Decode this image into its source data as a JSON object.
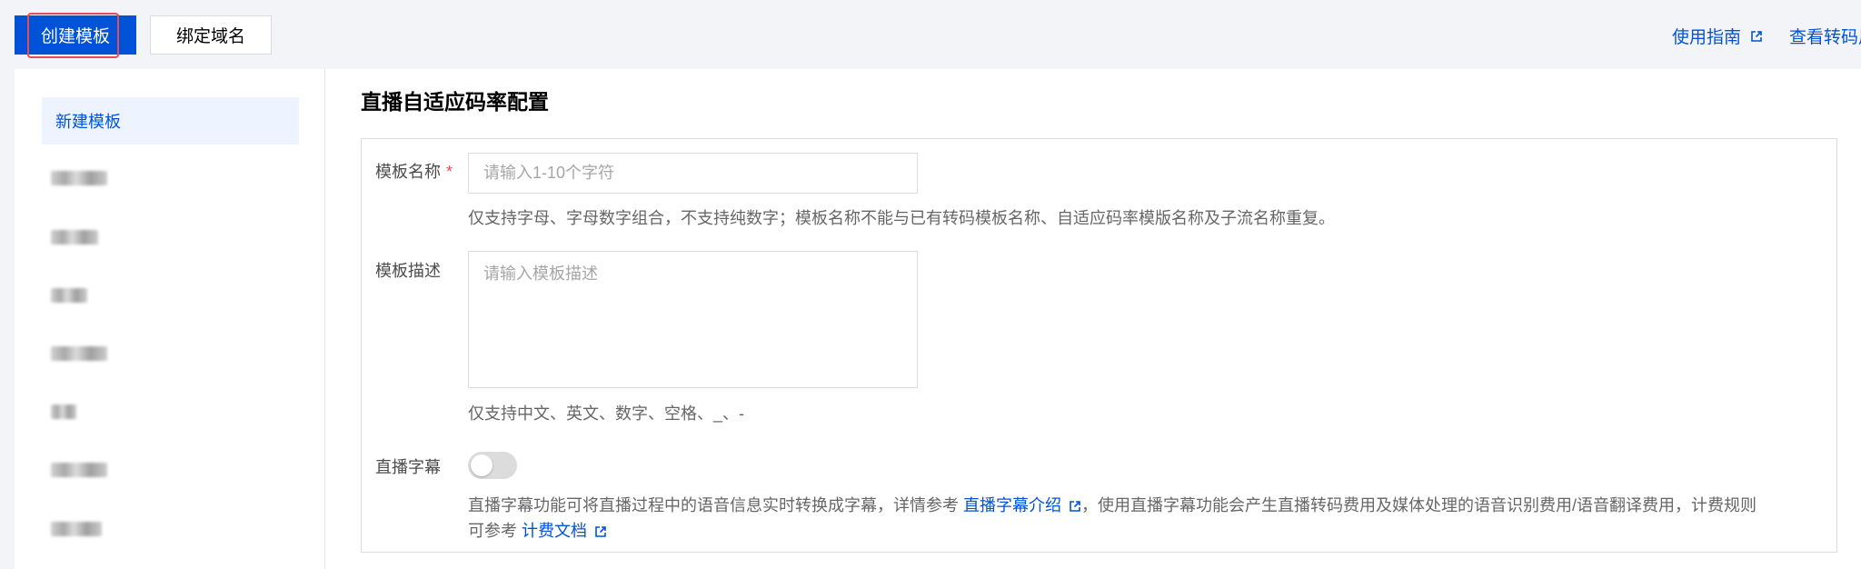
{
  "toolbar": {
    "create_label": "创建模板",
    "bind_label": "绑定域名"
  },
  "top_links": {
    "guide": "使用指南",
    "view": "查看转码用"
  },
  "sidebar": {
    "active_item": "新建模板",
    "items_count_blurred": 7
  },
  "section": {
    "title": "直播自适应码率配置"
  },
  "form": {
    "name": {
      "label": "模板名称",
      "required_mark": "*",
      "placeholder": "请输入1-10个字符",
      "value": "",
      "help": "仅支持字母、字母数字组合，不支持纯数字；模板名称不能与已有转码模板名称、自适应码率模版名称及子流名称重复。"
    },
    "description": {
      "label": "模板描述",
      "placeholder": "请输入模板描述",
      "value": "",
      "help": "仅支持中文、英文、数字、空格、_、-"
    },
    "subtitle": {
      "label": "直播字幕",
      "enabled": false,
      "desc_part1": "直播字幕功能可将直播过程中的语音信息实时转换成字幕，详情参考 ",
      "desc_link1": "直播字幕介绍",
      "desc_part2": "，使用直播字幕功能会产生直播转码费用及媒体处理的语音识别费用/语音翻译费用，计费规则可参考 ",
      "desc_link2": "计费文档"
    }
  },
  "colors": {
    "primary": "#0052d9",
    "required": "#e34d59",
    "highlight": "#e34d59",
    "background": "#f2f4f8"
  }
}
